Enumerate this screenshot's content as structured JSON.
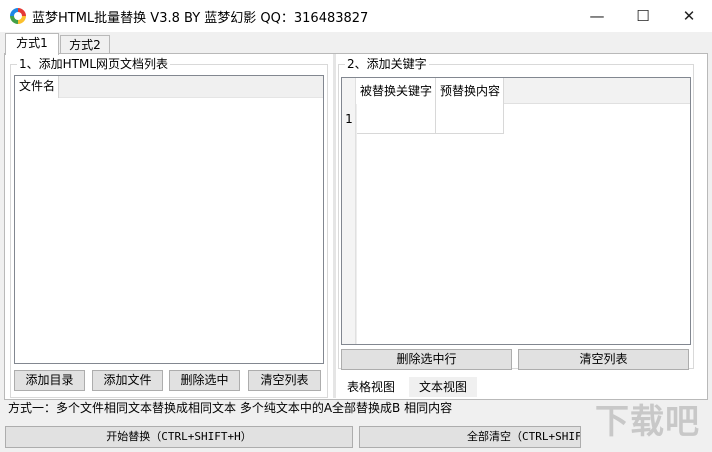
{
  "window": {
    "title": "蓝梦HTML批量替换 V3.8 BY 蓝梦幻影 QQ：316483827",
    "minimize_glyph": "—",
    "maximize_glyph": "☐",
    "close_glyph": "✕"
  },
  "tabs": [
    {
      "label": "方式1",
      "active": true
    },
    {
      "label": "方式2",
      "active": false
    }
  ],
  "left_group": {
    "label": "1、添加HTML网页文档列表",
    "columns": [
      "文件名"
    ],
    "buttons": [
      "添加目录",
      "添加文件",
      "删除选中",
      "清空列表"
    ]
  },
  "right_group": {
    "label": "2、添加关键字",
    "columns": [
      "被替换关键字",
      "预替换内容"
    ],
    "rows": [
      {
        "num": "1",
        "cells": [
          "",
          ""
        ]
      }
    ],
    "buttons": [
      "删除选中行",
      "清空列表"
    ],
    "view_tabs": [
      {
        "label": "表格视图",
        "active": true
      },
      {
        "label": "文本视图",
        "active": false
      }
    ]
  },
  "status": {
    "description": "方式一：多个文件相同文本替换成相同文本  多个纯文本中的A全部替换成B 相同内容"
  },
  "bottom_buttons": {
    "start": "开始替换（CTRL+SHIFT+H）",
    "clear_all": "全部清空（CTRL+SHIFT+"
  },
  "watermark": "下载吧",
  "colors": {
    "window_bg": "#f0f0f0",
    "button_bg": "#e1e1e1",
    "button_border": "#adadad",
    "list_border": "#828790"
  }
}
